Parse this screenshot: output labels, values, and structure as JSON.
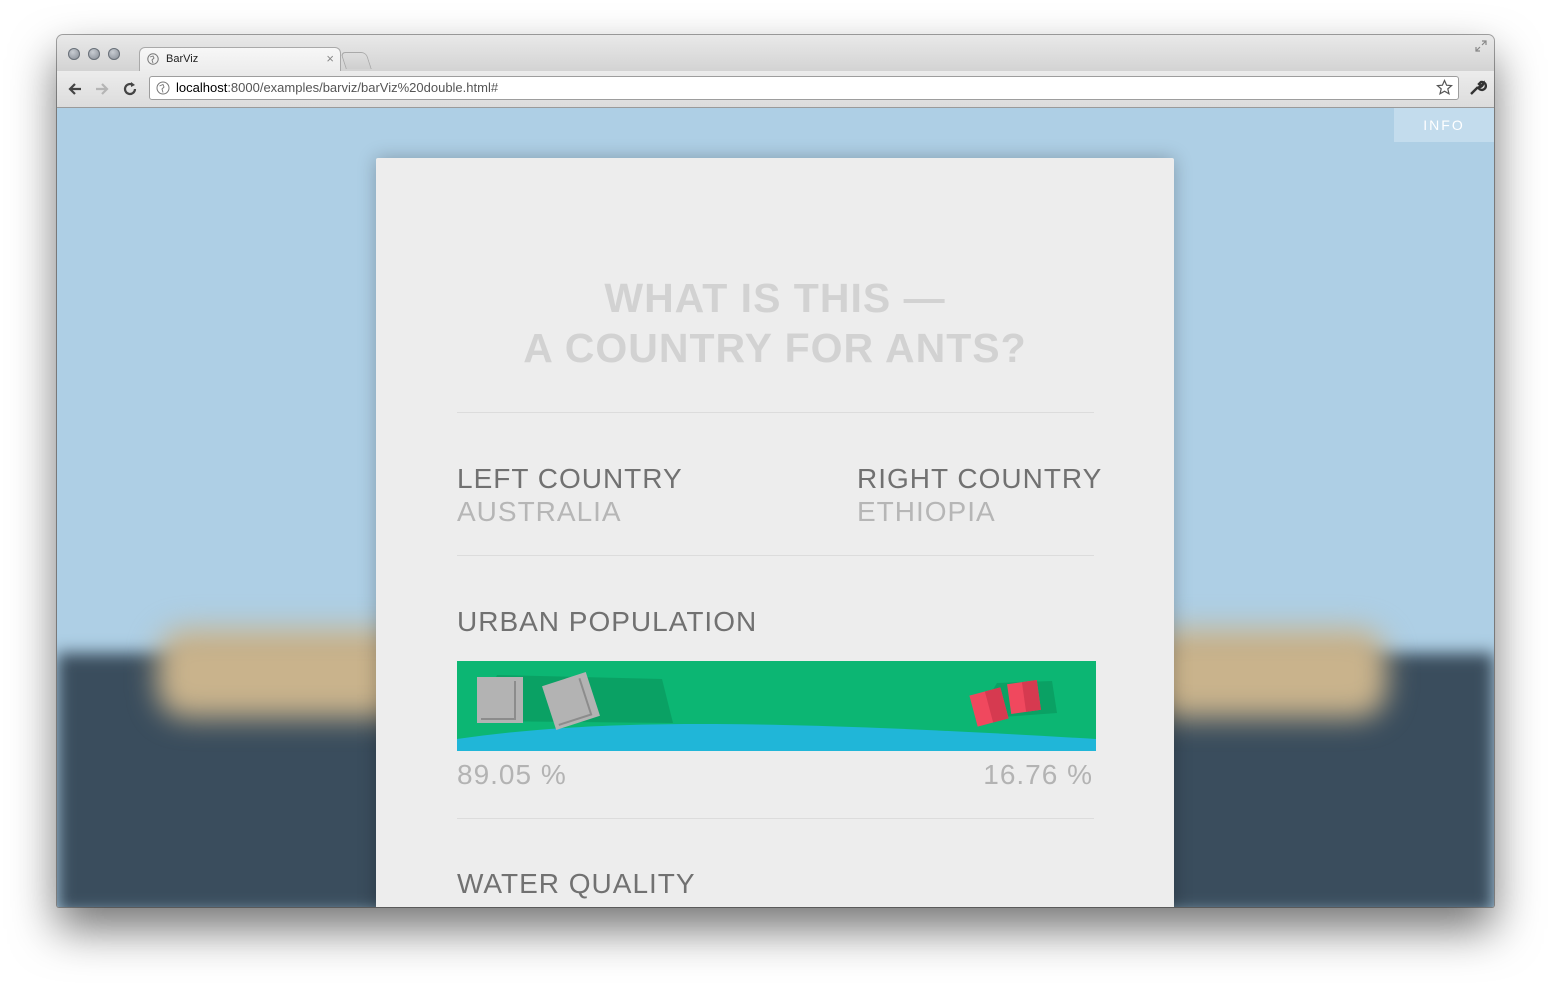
{
  "browser": {
    "tab_title": "BarViz",
    "url_host": "localhost",
    "url_rest": ":8000/examples/barviz/barViz%20double.html#"
  },
  "page": {
    "info_label": "INFO",
    "headline_line1": "WHAT IS THIS —",
    "headline_line2": "A COUNTRY FOR ANTS?",
    "left_heading": "LEFT COUNTRY",
    "left_country": "AUSTRALIA",
    "right_heading": "RIGHT COUNTRY",
    "right_country": "ETHIOPIA",
    "metrics": [
      {
        "title": "URBAN POPULATION",
        "left_value": "89.05 %",
        "right_value": "16.76 %"
      },
      {
        "title": "WATER QUALITY"
      }
    ]
  },
  "colors": {
    "background": "#aecfe5",
    "card": "#ededed",
    "bar_green": "#0cb673",
    "bar_water": "#20b6d8",
    "left_block": "#b3b3b3",
    "right_block": "#f0485e"
  }
}
